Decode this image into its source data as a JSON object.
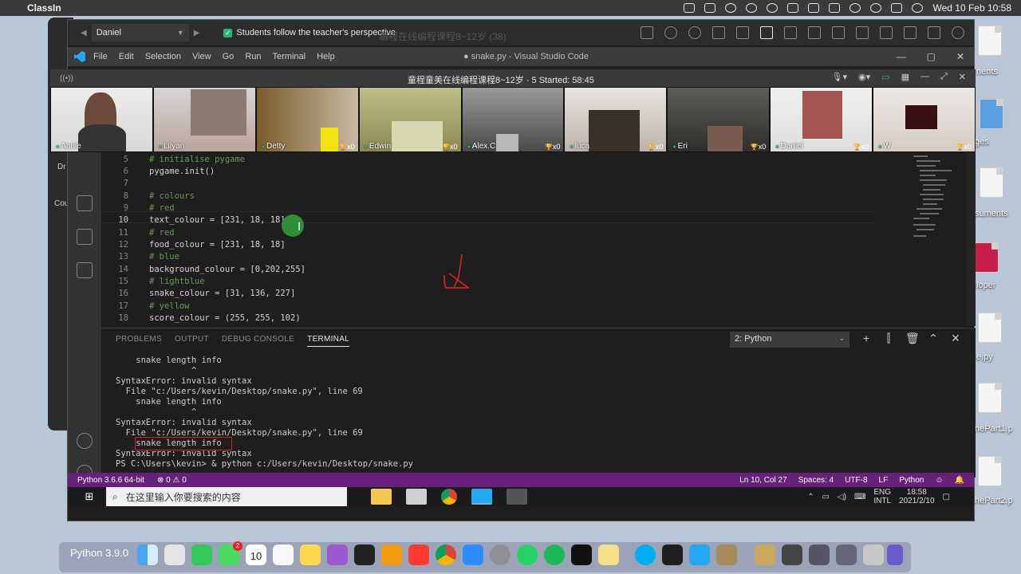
{
  "mac_menubar": {
    "app_name": "ClassIn",
    "clock": "Wed 10 Feb  10:58"
  },
  "desktop": {
    "labels": [
      "nents",
      "ges",
      "suments",
      "loper",
      "e.py",
      "hePart1.p",
      "hePart2.p"
    ]
  },
  "bg_app_labels": [
    "Dr",
    "Cou"
  ],
  "classin_bar": {
    "user_select": "Daniel",
    "perspective_label": "Students follow the teacher's perspective",
    "ghost_title": "编程在线编程课程8~12岁 (38)"
  },
  "vscode": {
    "menus": [
      "File",
      "Edit",
      "Selection",
      "View",
      "Go",
      "Run",
      "Terminal",
      "Help"
    ],
    "window_title": "● snake.py - Visual Studio Code",
    "controls": [
      "—",
      "▢",
      "✕"
    ]
  },
  "classroom": {
    "title": "童程童美在线编程课程8~12岁 · 5    Started: 58:45",
    "participants": [
      {
        "name": "Annie",
        "cups": ""
      },
      {
        "name": "Lilyan",
        "cups": ""
      },
      {
        "name": "Detty",
        "cups": "x0"
      },
      {
        "name": "Edwin",
        "cups": "x0"
      },
      {
        "name": "Alex.C",
        "cups": "x0"
      },
      {
        "name": "luca",
        "cups": "x0"
      },
      {
        "name": "Eri",
        "cups": "x0"
      },
      {
        "name": "Daniel",
        "cups": "x0"
      },
      {
        "name": "W",
        "cups": "x0"
      }
    ]
  },
  "editor": {
    "lines": [
      {
        "n": "5",
        "text": "# initialise pygame",
        "type": "comment"
      },
      {
        "n": "6",
        "text": "pygame.init()",
        "type": "code"
      },
      {
        "n": "7",
        "text": "",
        "type": "code"
      },
      {
        "n": "8",
        "text": "# colours",
        "type": "comment"
      },
      {
        "n": "9",
        "text": "# red",
        "type": "comment"
      },
      {
        "n": "10",
        "text": "text_colour = [231, 18, 18]",
        "type": "code"
      },
      {
        "n": "11",
        "text": "# red",
        "type": "comment"
      },
      {
        "n": "12",
        "text": "food_colour = [231, 18, 18]",
        "type": "code"
      },
      {
        "n": "13",
        "text": "# blue",
        "type": "comment"
      },
      {
        "n": "14",
        "text": "background_colour = [0,202,255]",
        "type": "code"
      },
      {
        "n": "15",
        "text": "# lightblue",
        "type": "comment"
      },
      {
        "n": "16",
        "text": "snake_colour = [31, 136, 227]",
        "type": "code"
      },
      {
        "n": "17",
        "text": "# yellow",
        "type": "comment"
      },
      {
        "n": "18",
        "text": "score_colour = (255, 255, 102)",
        "type": "code"
      }
    ]
  },
  "panel": {
    "tabs": [
      "PROBLEMS",
      "OUTPUT",
      "DEBUG CONSOLE",
      "TERMINAL"
    ],
    "active_tab": "TERMINAL",
    "terminal_select": "2: Python",
    "terminal_lines": [
      "    snake length info",
      "               ^",
      "SyntaxError: invalid syntax",
      "  File \"c:/Users/kevin/Desktop/snake.py\", line 69",
      "    snake length info",
      "               ^",
      "SyntaxError: invalid syntax",
      "  File \"c:/Users/kevin/Desktop/snake.py\", line 69",
      "    snake length info",
      "SyntaxError: invalid syntax",
      "PS C:\\Users\\kevin> & python c:/Users/kevin/Desktop/snake.py"
    ]
  },
  "statusbar": {
    "interpreter": "Python 3.6.6 64-bit",
    "problems": "⊗ 0  ⚠ 0",
    "position": "Ln 10, Col 27",
    "spaces": "Spaces: 4",
    "encoding": "UTF-8",
    "eol": "LF",
    "language": "Python"
  },
  "windows_taskbar": {
    "search_placeholder": "在这里输入你要搜索的内容",
    "lang_top": "ENG",
    "lang_bottom": "INTL",
    "time": "18:58",
    "date": "2021/2/10"
  },
  "dock": {
    "python_label": "Python 3.9.0",
    "calendar_day": "10",
    "badge_count": "2"
  },
  "colors": {
    "status_bar": "#68217a",
    "accent_green": "#2fb26b",
    "annotation_red": "#e02020"
  }
}
